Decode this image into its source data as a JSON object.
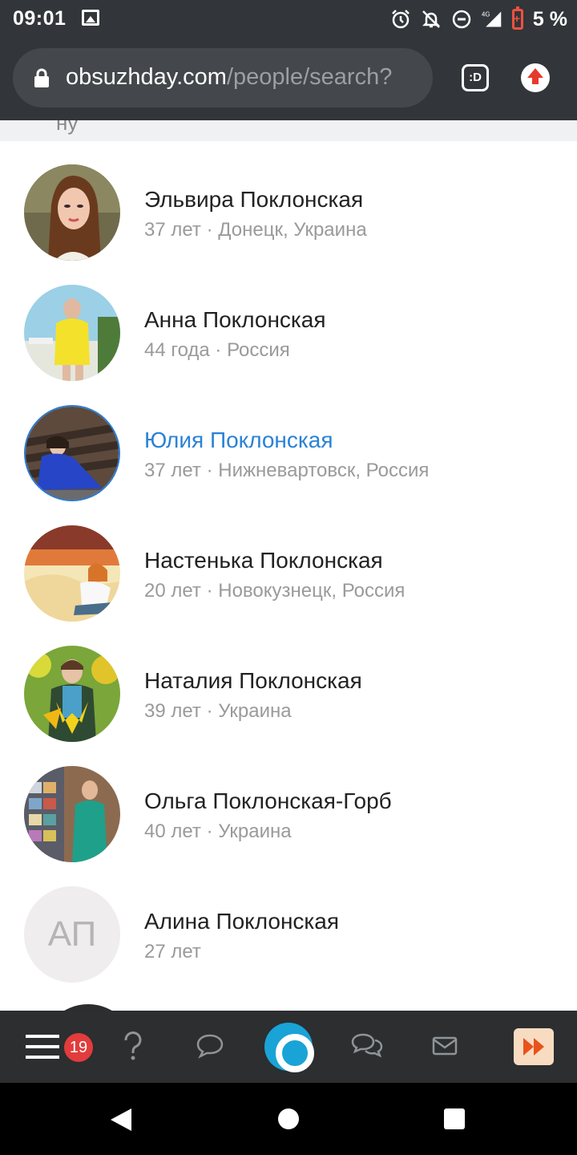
{
  "status_bar": {
    "time": "09:01",
    "network": "4G",
    "battery": "5 %"
  },
  "browser": {
    "url_domain": "obsuzhday.com",
    "url_path": "/people/search?",
    "extension_label": ":D"
  },
  "partial_text": "ну",
  "people": [
    {
      "name": "Эльвира Поклонская",
      "meta": "37 лет · Донецк, Украина",
      "avatar": "photo"
    },
    {
      "name": "Анна Поклонская",
      "meta": "44 года · Россия",
      "avatar": "photo"
    },
    {
      "name": "Юлия Поклонская",
      "meta": "37 лет · Нижневартовск, Россия",
      "avatar": "photo",
      "highlighted": true
    },
    {
      "name": "Настенька Поклонская",
      "meta": "20 лет · Новокузнецк, Россия",
      "avatar": "photo"
    },
    {
      "name": "Наталия Поклонская",
      "meta": "39 лет · Украина",
      "avatar": "photo"
    },
    {
      "name": "Ольга Поклонская-Горб",
      "meta": "40 лет · Украина",
      "avatar": "photo"
    },
    {
      "name": "Алина Поклонская",
      "meta": "27 лет",
      "avatar": "initials",
      "initials": "АП"
    }
  ],
  "toolbar": {
    "menu_badge": "19",
    "icons": [
      "menu-icon",
      "question-icon",
      "chat-bubble-icon",
      "home-logo-icon",
      "discussions-icon",
      "mail-icon",
      "fast-forward-icon"
    ]
  },
  "colors": {
    "link": "#2a82d5",
    "badge": "#e23c3c",
    "center_button": "#1aa3d6",
    "bar": "#323539"
  }
}
